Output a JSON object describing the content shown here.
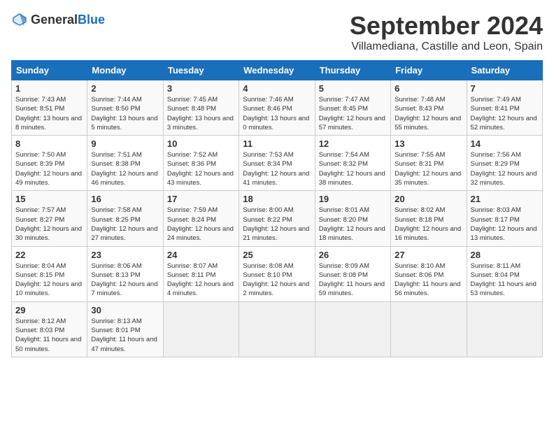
{
  "header": {
    "logo_general": "General",
    "logo_blue": "Blue",
    "month_title": "September 2024",
    "location": "Villamediana, Castille and Leon, Spain"
  },
  "days_of_week": [
    "Sunday",
    "Monday",
    "Tuesday",
    "Wednesday",
    "Thursday",
    "Friday",
    "Saturday"
  ],
  "weeks": [
    [
      {
        "day": "1",
        "sunrise": "Sunrise: 7:43 AM",
        "sunset": "Sunset: 8:51 PM",
        "daylight": "Daylight: 13 hours and 8 minutes."
      },
      {
        "day": "2",
        "sunrise": "Sunrise: 7:44 AM",
        "sunset": "Sunset: 8:50 PM",
        "daylight": "Daylight: 13 hours and 5 minutes."
      },
      {
        "day": "3",
        "sunrise": "Sunrise: 7:45 AM",
        "sunset": "Sunset: 8:48 PM",
        "daylight": "Daylight: 13 hours and 3 minutes."
      },
      {
        "day": "4",
        "sunrise": "Sunrise: 7:46 AM",
        "sunset": "Sunset: 8:46 PM",
        "daylight": "Daylight: 13 hours and 0 minutes."
      },
      {
        "day": "5",
        "sunrise": "Sunrise: 7:47 AM",
        "sunset": "Sunset: 8:45 PM",
        "daylight": "Daylight: 12 hours and 57 minutes."
      },
      {
        "day": "6",
        "sunrise": "Sunrise: 7:48 AM",
        "sunset": "Sunset: 8:43 PM",
        "daylight": "Daylight: 12 hours and 55 minutes."
      },
      {
        "day": "7",
        "sunrise": "Sunrise: 7:49 AM",
        "sunset": "Sunset: 8:41 PM",
        "daylight": "Daylight: 12 hours and 52 minutes."
      }
    ],
    [
      {
        "day": "8",
        "sunrise": "Sunrise: 7:50 AM",
        "sunset": "Sunset: 8:39 PM",
        "daylight": "Daylight: 12 hours and 49 minutes."
      },
      {
        "day": "9",
        "sunrise": "Sunrise: 7:51 AM",
        "sunset": "Sunset: 8:38 PM",
        "daylight": "Daylight: 12 hours and 46 minutes."
      },
      {
        "day": "10",
        "sunrise": "Sunrise: 7:52 AM",
        "sunset": "Sunset: 8:36 PM",
        "daylight": "Daylight: 12 hours and 43 minutes."
      },
      {
        "day": "11",
        "sunrise": "Sunrise: 7:53 AM",
        "sunset": "Sunset: 8:34 PM",
        "daylight": "Daylight: 12 hours and 41 minutes."
      },
      {
        "day": "12",
        "sunrise": "Sunrise: 7:54 AM",
        "sunset": "Sunset: 8:32 PM",
        "daylight": "Daylight: 12 hours and 38 minutes."
      },
      {
        "day": "13",
        "sunrise": "Sunrise: 7:55 AM",
        "sunset": "Sunset: 8:31 PM",
        "daylight": "Daylight: 12 hours and 35 minutes."
      },
      {
        "day": "14",
        "sunrise": "Sunrise: 7:56 AM",
        "sunset": "Sunset: 8:29 PM",
        "daylight": "Daylight: 12 hours and 32 minutes."
      }
    ],
    [
      {
        "day": "15",
        "sunrise": "Sunrise: 7:57 AM",
        "sunset": "Sunset: 8:27 PM",
        "daylight": "Daylight: 12 hours and 30 minutes."
      },
      {
        "day": "16",
        "sunrise": "Sunrise: 7:58 AM",
        "sunset": "Sunset: 8:25 PM",
        "daylight": "Daylight: 12 hours and 27 minutes."
      },
      {
        "day": "17",
        "sunrise": "Sunrise: 7:59 AM",
        "sunset": "Sunset: 8:24 PM",
        "daylight": "Daylight: 12 hours and 24 minutes."
      },
      {
        "day": "18",
        "sunrise": "Sunrise: 8:00 AM",
        "sunset": "Sunset: 8:22 PM",
        "daylight": "Daylight: 12 hours and 21 minutes."
      },
      {
        "day": "19",
        "sunrise": "Sunrise: 8:01 AM",
        "sunset": "Sunset: 8:20 PM",
        "daylight": "Daylight: 12 hours and 18 minutes."
      },
      {
        "day": "20",
        "sunrise": "Sunrise: 8:02 AM",
        "sunset": "Sunset: 8:18 PM",
        "daylight": "Daylight: 12 hours and 16 minutes."
      },
      {
        "day": "21",
        "sunrise": "Sunrise: 8:03 AM",
        "sunset": "Sunset: 8:17 PM",
        "daylight": "Daylight: 12 hours and 13 minutes."
      }
    ],
    [
      {
        "day": "22",
        "sunrise": "Sunrise: 8:04 AM",
        "sunset": "Sunset: 8:15 PM",
        "daylight": "Daylight: 12 hours and 10 minutes."
      },
      {
        "day": "23",
        "sunrise": "Sunrise: 8:06 AM",
        "sunset": "Sunset: 8:13 PM",
        "daylight": "Daylight: 12 hours and 7 minutes."
      },
      {
        "day": "24",
        "sunrise": "Sunrise: 8:07 AM",
        "sunset": "Sunset: 8:11 PM",
        "daylight": "Daylight: 12 hours and 4 minutes."
      },
      {
        "day": "25",
        "sunrise": "Sunrise: 8:08 AM",
        "sunset": "Sunset: 8:10 PM",
        "daylight": "Daylight: 12 hours and 2 minutes."
      },
      {
        "day": "26",
        "sunrise": "Sunrise: 8:09 AM",
        "sunset": "Sunset: 8:08 PM",
        "daylight": "Daylight: 11 hours and 59 minutes."
      },
      {
        "day": "27",
        "sunrise": "Sunrise: 8:10 AM",
        "sunset": "Sunset: 8:06 PM",
        "daylight": "Daylight: 11 hours and 56 minutes."
      },
      {
        "day": "28",
        "sunrise": "Sunrise: 8:11 AM",
        "sunset": "Sunset: 8:04 PM",
        "daylight": "Daylight: 11 hours and 53 minutes."
      }
    ],
    [
      {
        "day": "29",
        "sunrise": "Sunrise: 8:12 AM",
        "sunset": "Sunset: 8:03 PM",
        "daylight": "Daylight: 11 hours and 50 minutes."
      },
      {
        "day": "30",
        "sunrise": "Sunrise: 8:13 AM",
        "sunset": "Sunset: 8:01 PM",
        "daylight": "Daylight: 11 hours and 47 minutes."
      },
      null,
      null,
      null,
      null,
      null
    ]
  ]
}
